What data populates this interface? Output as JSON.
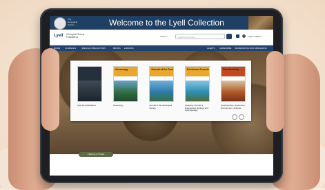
{
  "banner": {
    "society_label": "The Geological Society",
    "title": "Welcome to the Lyell Collection"
  },
  "header": {
    "brand": "Lyell",
    "brand_sub": "Geological Society Publications",
    "search_label": "Search",
    "search_placeholder": "Search our content",
    "login": "Login / register"
  },
  "nav": {
    "items": [
      "HOME",
      "JOURNALS",
      "SPECIAL PUBLICATIONS",
      "BOOKS",
      "E-BOOKS"
    ],
    "right_items": [
      "ALERTS",
      "SUBSCRIBE",
      "INFORMATION FOR LIBRARIANS"
    ]
  },
  "books": [
    {
      "title": "",
      "label": "Special Publications"
    },
    {
      "title": "Geoenergy",
      "label": "Geoenergy"
    },
    {
      "title": "Journal of the Geological Society",
      "label": "Journal of the Geological Society"
    },
    {
      "title": "Petroleum Geoscience",
      "label": "Quarterly Journal of Engineering Geology and Hydrogeology"
    },
    {
      "title": "Geochemistry",
      "label": "Geochemistry: Exploration, Environment, Analysis"
    }
  ],
  "view_all_label": "VIEW ALL TITLES"
}
